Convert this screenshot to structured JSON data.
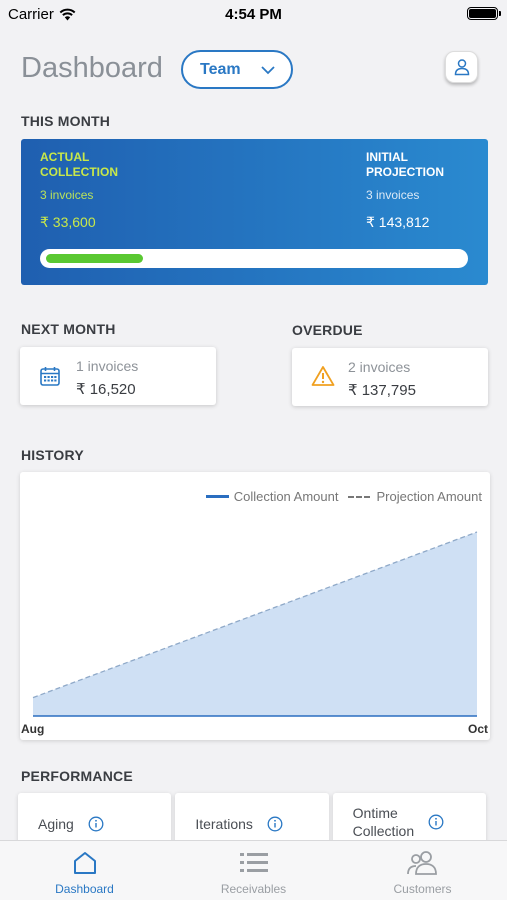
{
  "status": {
    "carrier": "Carrier",
    "time": "4:54 PM"
  },
  "header": {
    "title": "Dashboard",
    "team_label": "Team"
  },
  "this_month": {
    "label": "THIS MONTH",
    "actual": {
      "line1": "ACTUAL",
      "line2": "COLLECTION",
      "invoices": "3 invoices",
      "amount": "₹ 33,600"
    },
    "projection": {
      "line1": "INITIAL",
      "line2": "PROJECTION",
      "invoices": "3 invoices",
      "amount": "₹ 143,812"
    },
    "progress_fraction": 0.234
  },
  "next_month": {
    "label": "NEXT MONTH",
    "invoices": "1 invoices",
    "amount": "₹ 16,520"
  },
  "overdue": {
    "label": "OVERDUE",
    "invoices": "2 invoices",
    "amount": "₹ 137,795"
  },
  "history": {
    "label": "HISTORY",
    "legend": {
      "collection": "Collection Amount",
      "projection": "Projection Amount"
    },
    "x_start": "Aug",
    "x_end": "Oct"
  },
  "chart_data": {
    "type": "area",
    "x": [
      "Aug",
      "Oct"
    ],
    "series": [
      {
        "name": "Collection Amount",
        "values": [
          0,
          0
        ]
      },
      {
        "name": "Projection Amount",
        "values": [
          0.1,
          1.0
        ]
      }
    ],
    "legend_position": "top-right",
    "grid": false
  },
  "performance": {
    "label": "PERFORMANCE",
    "cards": [
      {
        "line1": "Aging",
        "line2": ""
      },
      {
        "line1": "Iterations",
        "line2": ""
      },
      {
        "line1": "Ontime",
        "line2": "Collection"
      }
    ]
  },
  "tabs": [
    {
      "label": "Dashboard",
      "icon": "home-icon"
    },
    {
      "label": "Receivables",
      "icon": "list-icon"
    },
    {
      "label": "Customers",
      "icon": "people-icon"
    }
  ],
  "colors": {
    "accent": "#2a78c4",
    "progress": "#5ac832",
    "card_gradient_start": "#1f5fb0",
    "card_gradient_end": "#2a8ad0"
  }
}
